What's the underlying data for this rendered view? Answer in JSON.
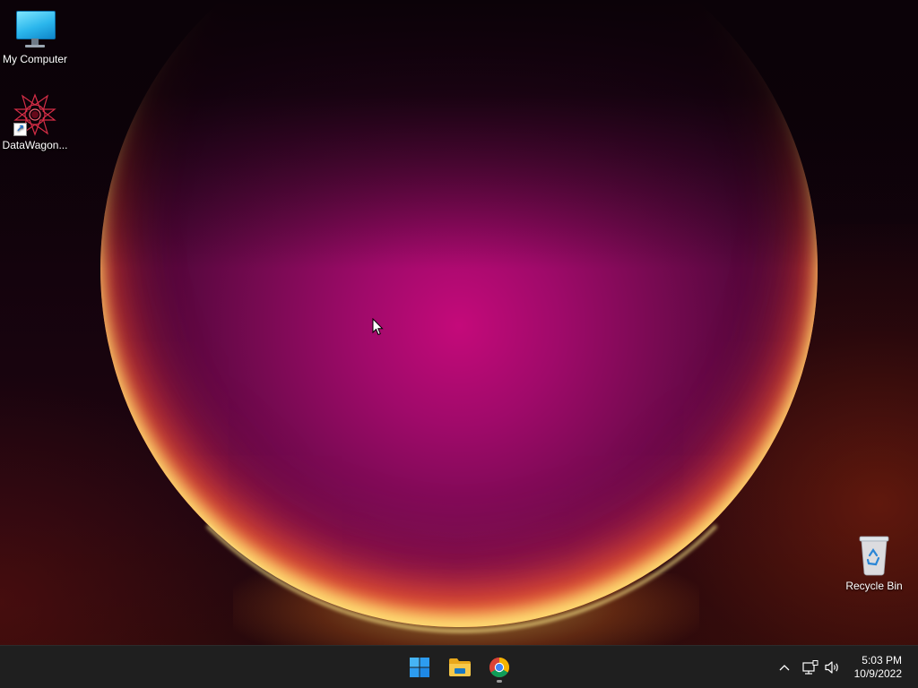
{
  "desktop": {
    "icons": [
      {
        "label": "My Computer",
        "icon": "monitor-icon"
      },
      {
        "label": "DataWagon...",
        "icon": "datawagon-app-icon"
      },
      {
        "label": "Recycle Bin",
        "icon": "recycle-bin-icon"
      }
    ]
  },
  "taskbar": {
    "pinned": [
      {
        "name": "Start",
        "icon": "windows-start-icon",
        "active": false
      },
      {
        "name": "File Explorer",
        "icon": "folder-icon",
        "active": false
      },
      {
        "name": "Google Chrome",
        "icon": "chrome-icon",
        "active": true
      }
    ],
    "tray": {
      "overflow_icon": "chevron-up-icon",
      "network_icon": "network-icon",
      "volume_icon": "speaker-icon"
    },
    "clock": {
      "time": "5:03 PM",
      "date": "10/9/2022"
    }
  },
  "colors": {
    "taskbar_bg": "#1f1f1f",
    "start_blue": "#2d9cf0",
    "folder_yellow": "#f4c430"
  }
}
